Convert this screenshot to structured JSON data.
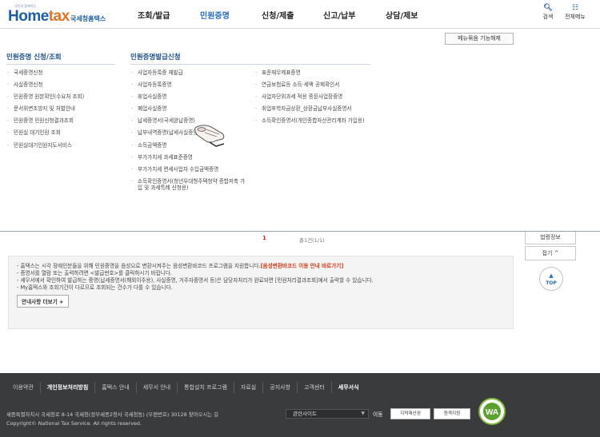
{
  "header": {
    "logo_tag": "국민과 함께하는",
    "logo_word_home": "Home",
    "logo_word_tax": "tax",
    "logo_kr": "국세청홈택스",
    "nav": [
      "조회/발급",
      "민원증명",
      "신청/제출",
      "신고/납부",
      "상담/제보"
    ],
    "active_nav": "민원증명",
    "search_label": "검색",
    "allmenu_label": "전체메뉴"
  },
  "mega": {
    "fav_button": "메뉴묶음 기능해제",
    "col1_title": "민원증명 신청/조회",
    "col1_items": [
      "국세증명신청",
      "사실증명신청",
      "민원증명 원본확인(수요처 조회)",
      "문서위변조방지 및 처벌안내",
      "민원증명 민원신청결과조회",
      "민원실 대기인원 조회",
      "민원실대기인원지도서비스"
    ],
    "col2_title": "민원증명발급신청",
    "col2_items": [
      "사업자등록증 재발급",
      "사업자등록증명",
      "휴업사실증명",
      "폐업사실증명",
      "납세증명서(국세완납증명)",
      "납부내역증명(납세사실증명)",
      "소득금액증명",
      "부가가치세 과세표준증명",
      "부가가치세 면세사업자 수입금액증명",
      "소득확인증명서(청년우대형주택청약 종합저축 가입 및 과세특례 신청용)"
    ],
    "col3_items": [
      "표준재무제표증명",
      "연금보험료등 소득·세액 공제확인서",
      "사업자단위과세 적용 종된사업장증명",
      "취업후학자금상환_상환금납부사실증명서",
      "소득확인증명서(개인종합자산관리계좌 가입용)"
    ]
  },
  "list": {
    "page": "1",
    "count": "총1건(1/1)",
    "quick_link": "법령정보",
    "fold": "접기 ^",
    "top": "TOP",
    "info_lines": [
      "- 홈택스는 시각 장애인분들을 위해 민원증명을 음성으로 변환시켜주는 음성변환바코드 프로그램을 지원합니다.",
      "- 증명서를 열람 또는 출력하려면 <발급번호>를 클릭하시기 바랍니다.",
      "- 세무서에서 확인하여 발급하는 증명(납세증명서(해외이주용), 사실증명, 거주자증명서 등)은 담당자처리가 완료되면 [민원처리결과조회]에서 출력할 수 있습니다.",
      "- My홈택스와 조회기간이 다르므로 조회되는 건수가 다를 수 있습니다."
    ],
    "info_link": "[음성변환바코드 이용 안내 바로가기]",
    "more_button": "안내사항 더보기 +"
  },
  "footer": {
    "nav": [
      "이용약관",
      "개인정보처리방침",
      "홈택스 안내",
      "세무서 안내",
      "통합설치 프로그램",
      "자료실",
      "공지사항",
      "고객센터",
      "세무서식"
    ],
    "highlight": "개인정보처리방침",
    "address": "세종특별자치시 국세청로 8-14 국세청(정부세종2청사 국세청동) (우편번호) 30128",
    "copyright": "Copyright© National Tax Service. All rights reserved.",
    "directions": "찾아오시는 길",
    "related_site": "관련사이트",
    "move": "이동",
    "badge1": "지적재산권",
    "badge2": "원격지원",
    "wa_label": "WA"
  },
  "colors": {
    "brand_blue": "#1d5ea8",
    "brand_orange": "#e3731c",
    "active_nav": "#2a6cc0",
    "info_link": "#d93b1b",
    "footer_bg": "#3a3b3d"
  }
}
